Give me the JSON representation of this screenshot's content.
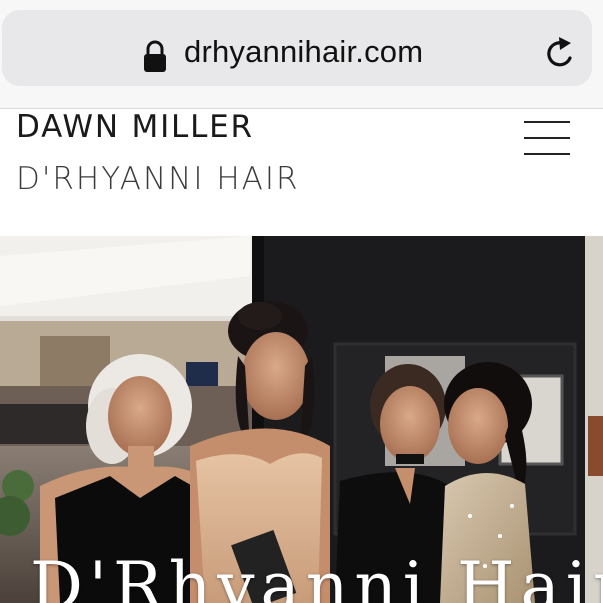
{
  "browser": {
    "url": "drhyannihair.com",
    "lock_icon": "lock-icon",
    "reload_icon": "reload-icon"
  },
  "header": {
    "brand_name": "DAWN MILLER",
    "brand_sub": "D'RHYANNI HAIR",
    "menu_icon": "hamburger-menu-icon"
  },
  "hero": {
    "title": "D'Rhyanni Hair"
  }
}
